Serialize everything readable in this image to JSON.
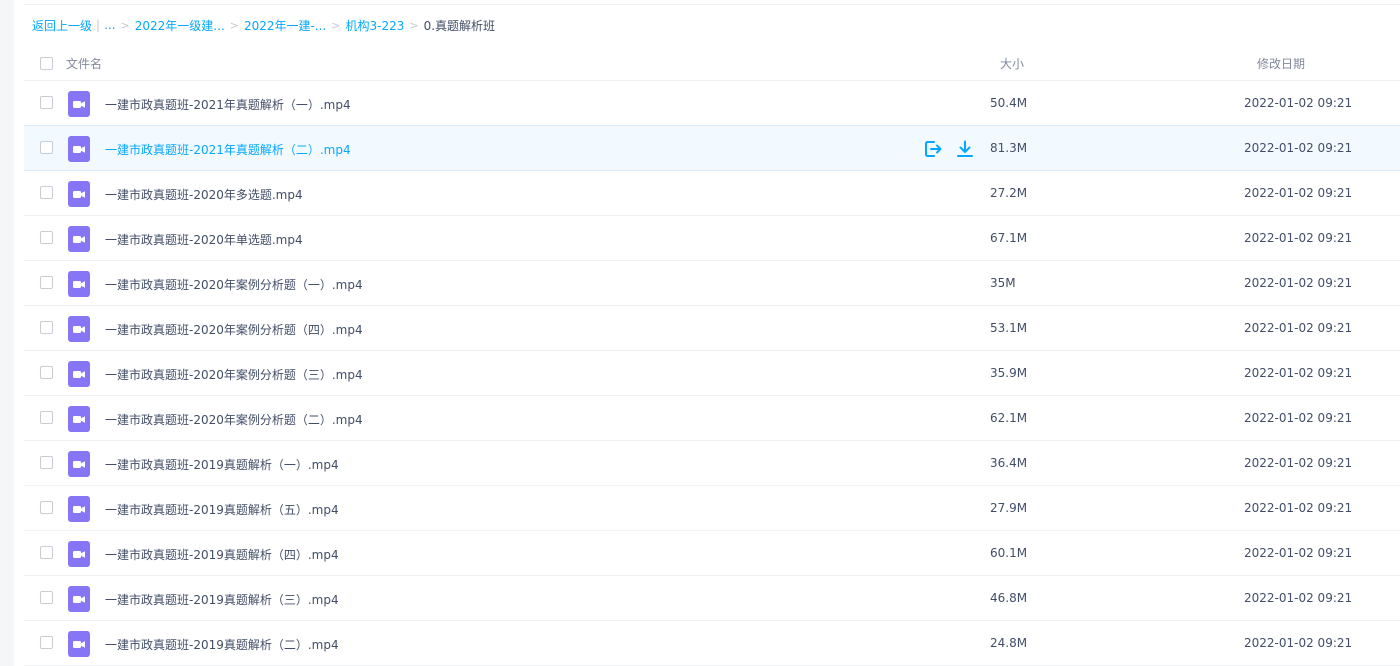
{
  "breadcrumb": {
    "back_label": "返回上一级",
    "ellipsis": "...",
    "items": [
      "2022年一级建...",
      "2022年一建-...",
      "机构3-223"
    ],
    "current": "0.真题解析班"
  },
  "table": {
    "columns": {
      "name": "文件名",
      "size": "大小",
      "date": "修改日期"
    },
    "rows": [
      {
        "name": "一建市政真题班-2021年真题解析（一）.mp4",
        "size": "50.4M",
        "date": "2022-01-02 09:21"
      },
      {
        "name": "一建市政真题班-2021年真题解析（二）.mp4",
        "size": "81.3M",
        "date": "2022-01-02 09:21"
      },
      {
        "name": "一建市政真题班-2020年多选题.mp4",
        "size": "27.2M",
        "date": "2022-01-02 09:21"
      },
      {
        "name": "一建市政真题班-2020年单选题.mp4",
        "size": "67.1M",
        "date": "2022-01-02 09:21"
      },
      {
        "name": "一建市政真题班-2020年案例分析题（一）.mp4",
        "size": "35M",
        "date": "2022-01-02 09:21"
      },
      {
        "name": "一建市政真题班-2020年案例分析题（四）.mp4",
        "size": "53.1M",
        "date": "2022-01-02 09:21"
      },
      {
        "name": "一建市政真题班-2020年案例分析题（三）.mp4",
        "size": "35.9M",
        "date": "2022-01-02 09:21"
      },
      {
        "name": "一建市政真题班-2020年案例分析题（二）.mp4",
        "size": "62.1M",
        "date": "2022-01-02 09:21"
      },
      {
        "name": "一建市政真题班-2019真题解析（一）.mp4",
        "size": "36.4M",
        "date": "2022-01-02 09:21"
      },
      {
        "name": "一建市政真题班-2019真题解析（五）.mp4",
        "size": "27.9M",
        "date": "2022-01-02 09:21"
      },
      {
        "name": "一建市政真题班-2019真题解析（四）.mp4",
        "size": "60.1M",
        "date": "2022-01-02 09:21"
      },
      {
        "name": "一建市政真题班-2019真题解析（三）.mp4",
        "size": "46.8M",
        "date": "2022-01-02 09:21"
      },
      {
        "name": "一建市政真题班-2019真题解析（二）.mp4",
        "size": "24.8M",
        "date": "2022-01-02 09:21"
      }
    ],
    "hovered_row": 1
  },
  "row_actions": {
    "icons": [
      "share-icon",
      "download-icon"
    ]
  },
  "colors": {
    "accent": "#06a7ff",
    "video_icon": "#8675f4",
    "text": "#424e67",
    "muted": "#818999"
  }
}
